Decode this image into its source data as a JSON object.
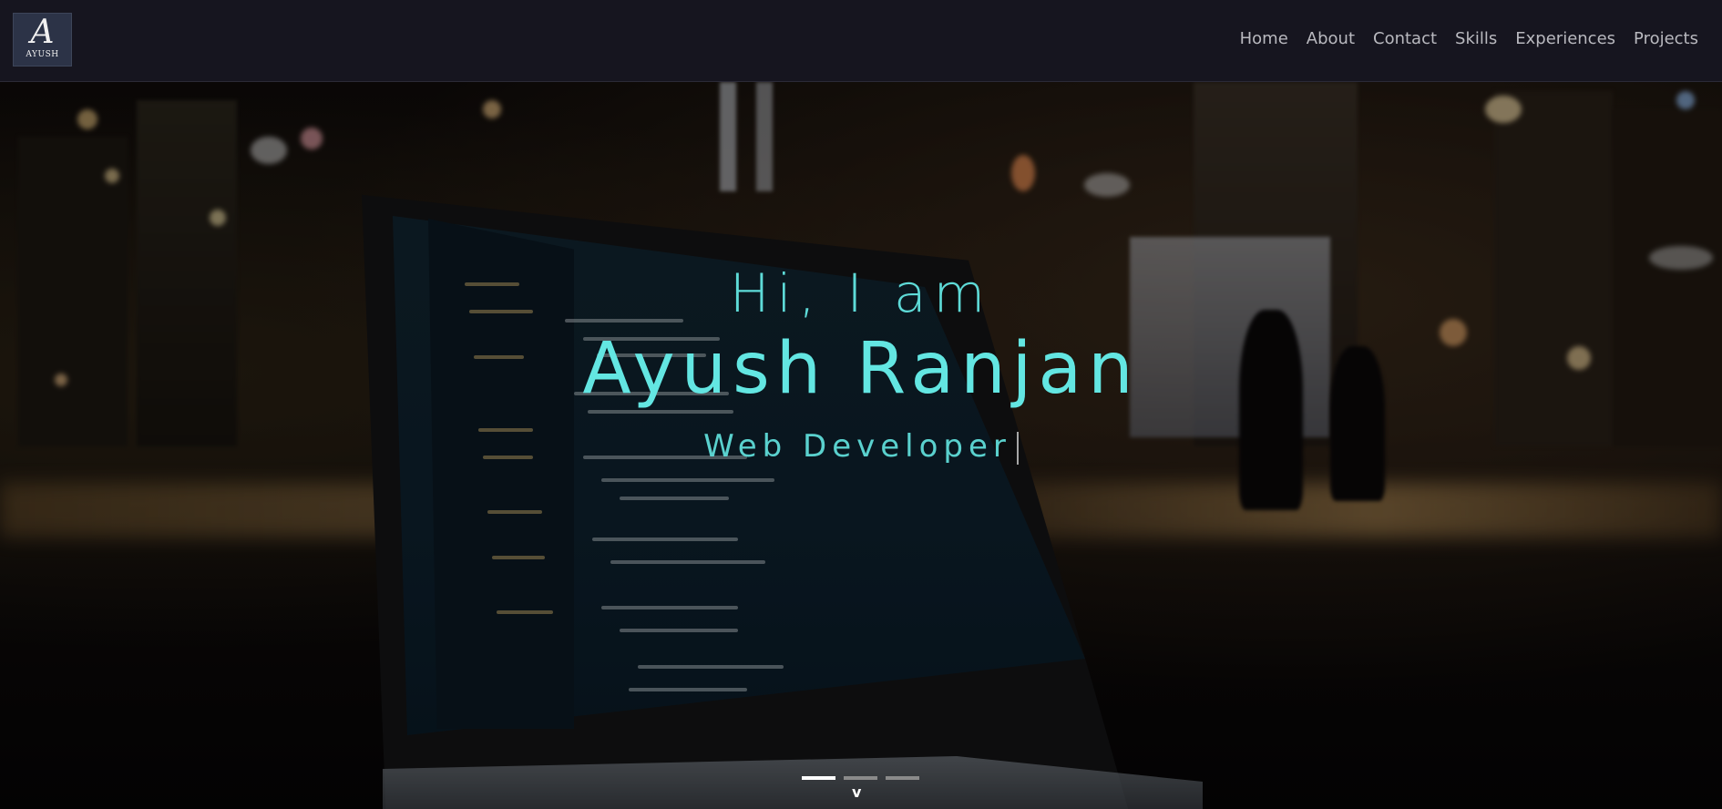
{
  "navbar": {
    "logo": {
      "letter": "A",
      "name": "AYUSH"
    },
    "links": [
      {
        "label": "Home"
      },
      {
        "label": "About"
      },
      {
        "label": "Contact"
      },
      {
        "label": "Skills"
      },
      {
        "label": "Experiences"
      },
      {
        "label": "Projects"
      }
    ]
  },
  "hero": {
    "greeting": "Hi, I am",
    "name": "Ayush Ranjan",
    "role": "Web Developer",
    "carousel": {
      "slides": 3,
      "active_index": 0
    },
    "scroll_icon": "chevron-down-icon",
    "accent_color": "#63e6e2"
  }
}
